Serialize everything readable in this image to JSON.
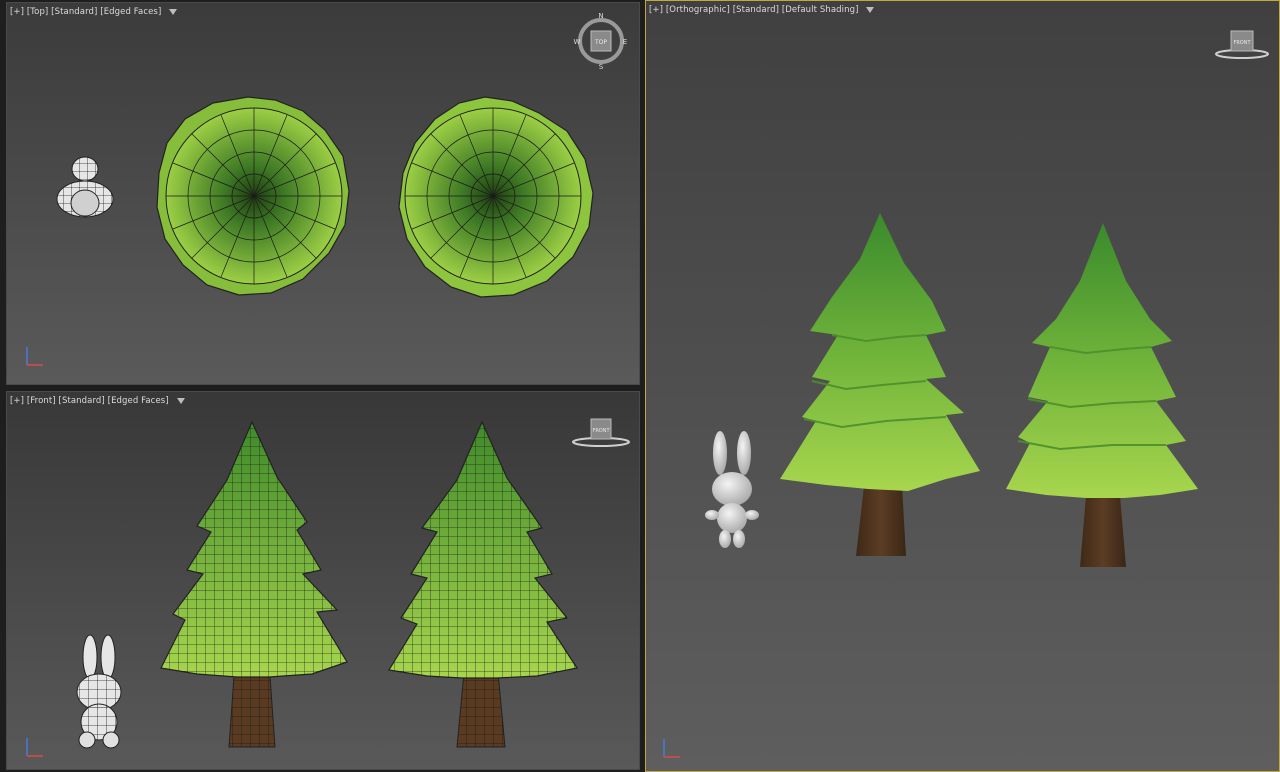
{
  "viewports": {
    "top": {
      "label": [
        "[+]",
        "[Top]",
        "[Standard]",
        "[Edged Faces]"
      ]
    },
    "front": {
      "label": [
        "[+]",
        "[Front]",
        "[Standard]",
        "[Edged Faces]"
      ]
    },
    "persp": {
      "label": [
        "[+]",
        "[Orthographic]",
        "[Standard]",
        "[Default Shading]"
      ]
    }
  },
  "viewcube": {
    "top_face": "TOP",
    "front_face": "FRONT",
    "compass": {
      "n": "N",
      "s": "S",
      "e": "E",
      "w": "W"
    }
  },
  "colors": {
    "active_viewport_border": "#c3a73f",
    "foliage_light": "#9ccf45",
    "foliage_dark": "#3f8a2a",
    "trunk": "#5a3b22",
    "character": "#d8d8d8"
  }
}
